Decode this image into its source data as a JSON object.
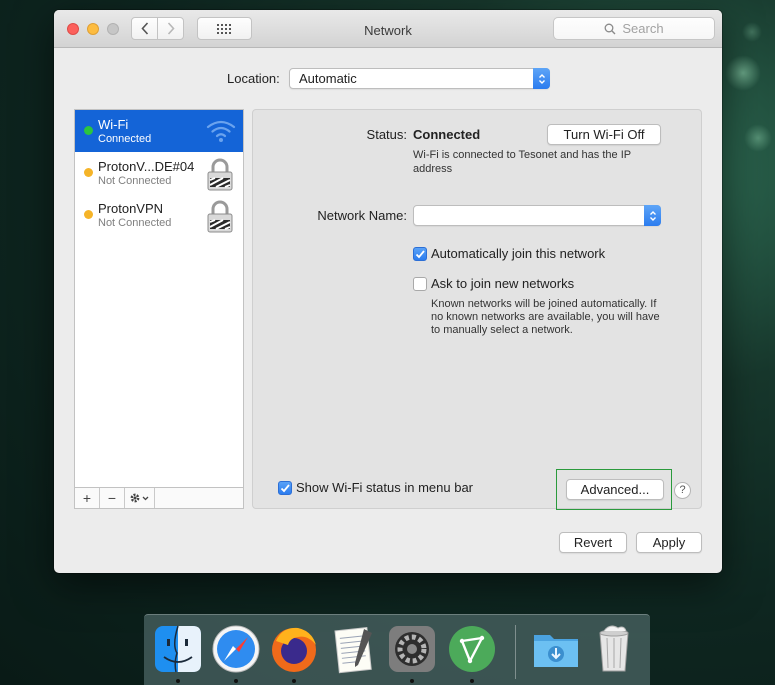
{
  "window": {
    "title": "Network",
    "search_placeholder": "Search"
  },
  "location": {
    "label": "Location:",
    "value": "Automatic"
  },
  "services": [
    {
      "name": "Wi-Fi",
      "status": "Connected",
      "status_color": "#2bc53f",
      "icon": "wifi-icon"
    },
    {
      "name": "ProtonV...DE#04",
      "status": "Not Connected",
      "status_color": "#f5b428",
      "icon": "lock-icon"
    },
    {
      "name": "ProtonVPN",
      "status": "Not Connected",
      "status_color": "#f5b428",
      "icon": "lock-icon"
    }
  ],
  "sidebar_controls": {
    "add": "+",
    "remove": "−"
  },
  "detail": {
    "status_label": "Status:",
    "status_value": "Connected",
    "toggle_button": "Turn Wi-Fi Off",
    "status_description_line1": "Wi-Fi is connected to Tesonet and has the IP",
    "status_description_line2": "address",
    "network_name_label": "Network Name:",
    "network_name_value": "",
    "auto_join_label": "Automatically join this network",
    "auto_join_checked": true,
    "ask_join_label": "Ask to join new networks",
    "ask_join_checked": false,
    "ask_join_help_line1": "Known networks will be joined automatically. If",
    "ask_join_help_line2": "no known networks are available, you will have",
    "ask_join_help_line3": "to manually select a network.",
    "show_status_label": "Show Wi-Fi status in menu bar",
    "show_status_checked": true,
    "advanced_button": "Advanced...",
    "help_button": "?"
  },
  "footer": {
    "revert": "Revert",
    "apply": "Apply"
  },
  "dock": {
    "apps": [
      "finder-icon",
      "safari-icon",
      "firefox-icon",
      "textedit-icon",
      "system-preferences-icon",
      "protonvpn-icon",
      "downloads-folder-icon",
      "trash-icon"
    ]
  },
  "colors": {
    "accent": "#1464d7",
    "checkbox_blue": "#2b7cef"
  }
}
